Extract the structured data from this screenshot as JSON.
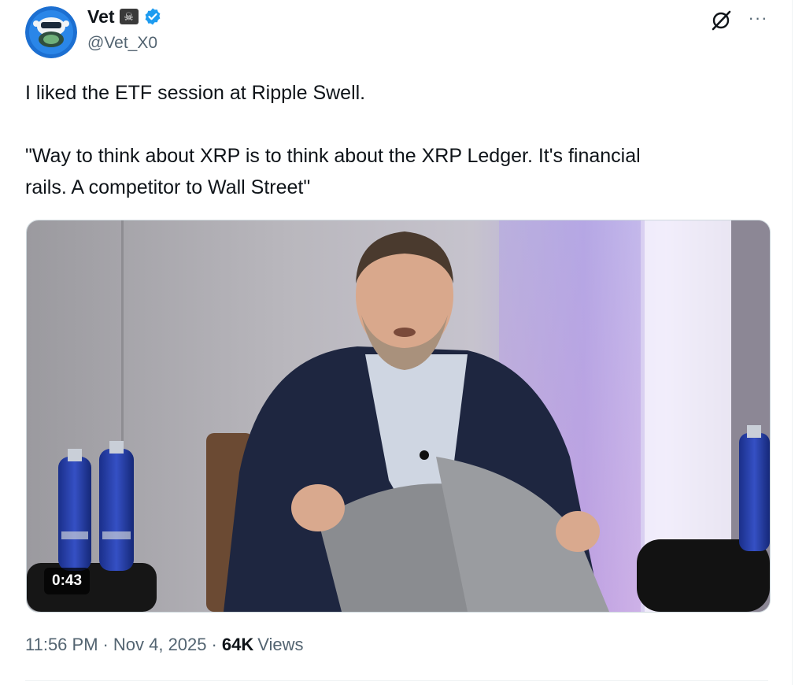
{
  "author": {
    "display_name": "Vet",
    "badge_icon": "skull-crossbones-badge",
    "verified": true,
    "handle": "@Vet_X0"
  },
  "header_actions": {
    "grok_icon": "grok-icon",
    "more_icon": "more-options-icon",
    "more_glyph": "···"
  },
  "post": {
    "line1": "I liked the ETF session at Ripple Swell.",
    "line2": "\"Way to think about XRP is to think about the XRP Ledger. It's financial",
    "line3": "rails. A competitor to Wall Street\""
  },
  "media": {
    "type": "video",
    "duration": "0:43"
  },
  "meta": {
    "time": "11:56 PM",
    "separator": "·",
    "date": "Nov 4, 2025",
    "views_count": "64K",
    "views_label": "Views"
  },
  "colors": {
    "verified_blue": "#1d9bf0",
    "secondary_text": "#536471",
    "primary_text": "#0f1419"
  }
}
